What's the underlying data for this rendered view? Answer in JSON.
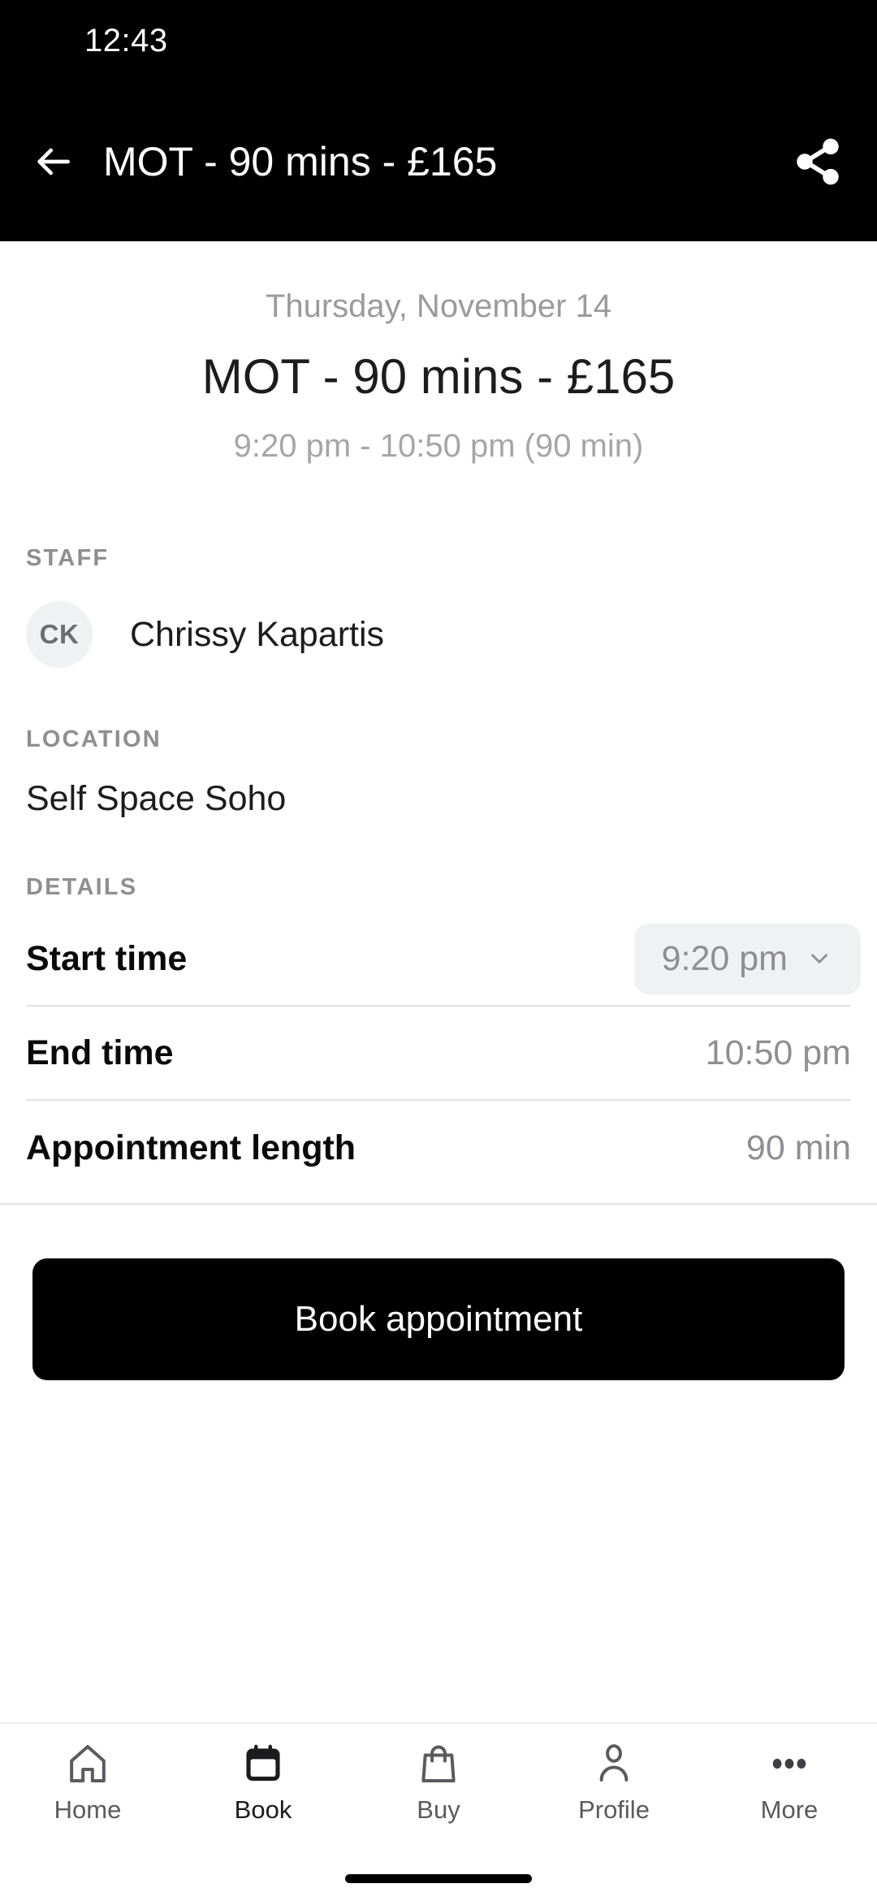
{
  "status_bar": {
    "time": "12:43"
  },
  "app_bar": {
    "back_icon": "arrow-left-icon",
    "title": "MOT - 90 mins - £165",
    "share_icon": "share-icon"
  },
  "hero": {
    "date": "Thursday, November 14",
    "service_title": "MOT - 90 mins - £165",
    "time_range": "9:20 pm - 10:50 pm (90 min)"
  },
  "staff": {
    "section_label": "STAFF",
    "avatar_initials": "CK",
    "name": "Chrissy Kapartis"
  },
  "location": {
    "section_label": "LOCATION",
    "name": "Self Space Soho"
  },
  "details": {
    "section_label": "DETAILS",
    "rows": [
      {
        "label": "Start time",
        "value": "9:20 pm",
        "type": "dropdown",
        "chevron_icon": "chevron-down-icon"
      },
      {
        "label": "End time",
        "value": "10:50 pm",
        "type": "text"
      },
      {
        "label": "Appointment length",
        "value": "90 min",
        "type": "text"
      }
    ]
  },
  "cta": {
    "label": "Book appointment"
  },
  "bottom_nav": {
    "items": [
      {
        "label": "Home",
        "icon": "home-icon",
        "active": false
      },
      {
        "label": "Book",
        "icon": "calendar-icon",
        "active": true
      },
      {
        "label": "Buy",
        "icon": "shopping-bag-icon",
        "active": false
      },
      {
        "label": "Profile",
        "icon": "person-icon",
        "active": false
      },
      {
        "label": "More",
        "icon": "ellipsis-icon",
        "active": false
      }
    ]
  },
  "colors": {
    "app_bar_bg": "#000000",
    "page_bg": "#ffffff",
    "primary_text": "#1c1c1e",
    "muted_text": "#8e8e93",
    "divider": "#e3e3e6",
    "pill_bg": "#f0f1f3",
    "cta_bg": "#000000"
  }
}
